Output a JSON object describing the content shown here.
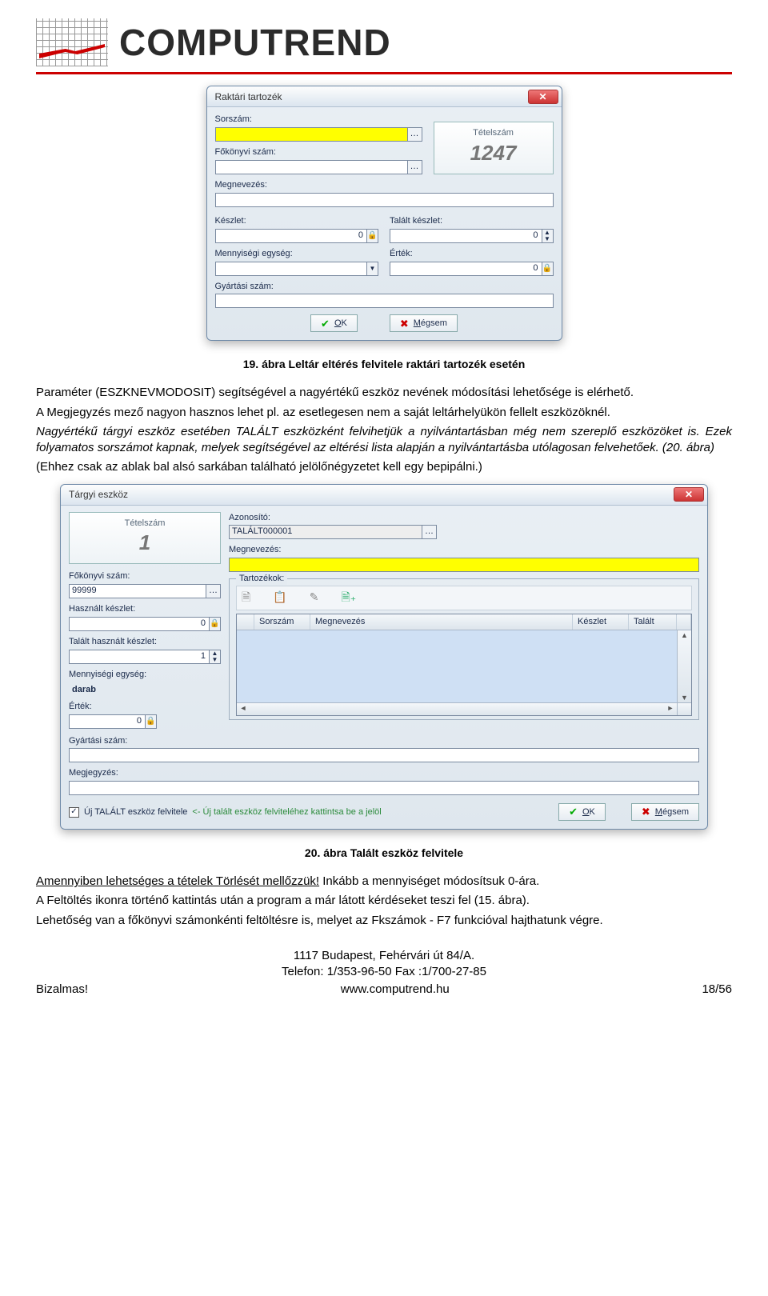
{
  "header": {
    "brand": "COMPUTREND"
  },
  "dialog1": {
    "title": "Raktári tartozék",
    "close": "✕",
    "sorszam_label": "Sorszám:",
    "fokonyvi_label": "Főkönyvi szám:",
    "tetelszam_label": "Tételszám",
    "tetelszam_value": "1247",
    "megnevezes_label": "Megnevezés:",
    "keszlet_label": "Készlet:",
    "keszlet_value": "0",
    "talalt_keszlet_label": "Talált készlet:",
    "talalt_keszlet_value": "0",
    "menny_label": "Mennyiségi egység:",
    "ertek_label": "Érték:",
    "ertek_value": "0",
    "gyartasi_label": "Gyártási szám:",
    "ok": "OK",
    "cancel": "Mégsem"
  },
  "caption1": "19. ábra Leltár eltérés felvitele raktári tartozék esetén",
  "text": {
    "p1": "Paraméter (ESZKNEVMODOSIT) segítségével a nagyértékű eszköz nevének módosítási lehetősége is elérhető.",
    "p2": "A Megjegyzés mező nagyon hasznos lehet pl. az esetlegesen nem a saját leltárhelyükön fellelt eszközöknél.",
    "p3": "Nagyértékű tárgyi eszköz esetében TALÁLT eszközként felvihetjük a nyilvántartásban még nem szereplő eszközöket is. Ezek folyamatos sorszámot kapnak, melyek segítségével az eltérési lista alapján a nyilvántartásba utólagosan felvehetőek. (20. ábra)",
    "p4": "(Ehhez csak az ablak bal alsó sarkában található jelölőnégyzetet kell egy bepipálni.)"
  },
  "dialog2": {
    "title": "Tárgyi eszköz",
    "close": "✕",
    "tetelszam_label": "Tételszám",
    "tetelszam_value": "1",
    "azonosito_label": "Azonosító:",
    "azonosito_value": "TALÁLT000001",
    "megnevezes_label": "Megnevezés:",
    "fokonyvi_label": "Főkönyvi szám:",
    "fokonyvi_value": "99999",
    "hasznalt_label": "Használt készlet:",
    "hasznalt_value": "0",
    "talalt_hasznalt_label": "Talált használt készlet:",
    "talalt_hasznalt_value": "1",
    "menny_label": "Mennyiségi egység:",
    "menny_value": "darab",
    "ertek_label": "Érték:",
    "ertek_value": "0",
    "gyartasi_label": "Gyártási szám:",
    "megjegyzes_label": "Megjegyzés:",
    "tartozekok_label": "Tartozékok:",
    "grid": {
      "h1": "",
      "h2": "Sorszám",
      "h3": "Megnevezés",
      "h4": "Készlet",
      "h5": "Talált"
    },
    "checkbox_label": "Új TALÁLT eszköz felvitele",
    "checkbox_hint": "<- Új talált eszköz felviteléhez kattintsa be a jelöl",
    "ok": "OK",
    "cancel": "Mégsem"
  },
  "caption2": "20. ábra Talált eszköz felvitele",
  "text2": {
    "p1a": "Amennyiben lehetséges a tételek Törlését mellőzzük!",
    "p1b": " Inkább a mennyiséget módosítsuk 0-ára.",
    "p2": "A Feltöltés ikonra történő kattintás után a program a már látott kérdéseket teszi fel (15. ábra).",
    "p3": "Lehetőség van a főkönyvi számonkénti feltöltésre is, melyet az Fkszámok - F7 funkcióval hajthatunk végre."
  },
  "footer": {
    "addr": "1117 Budapest, Fehérvári út 84/A.",
    "tel": "Telefon: 1/353-96-50  Fax :1/700-27-85",
    "left": "Bizalmas!",
    "url": "www.computrend.hu",
    "page": "18/56"
  }
}
